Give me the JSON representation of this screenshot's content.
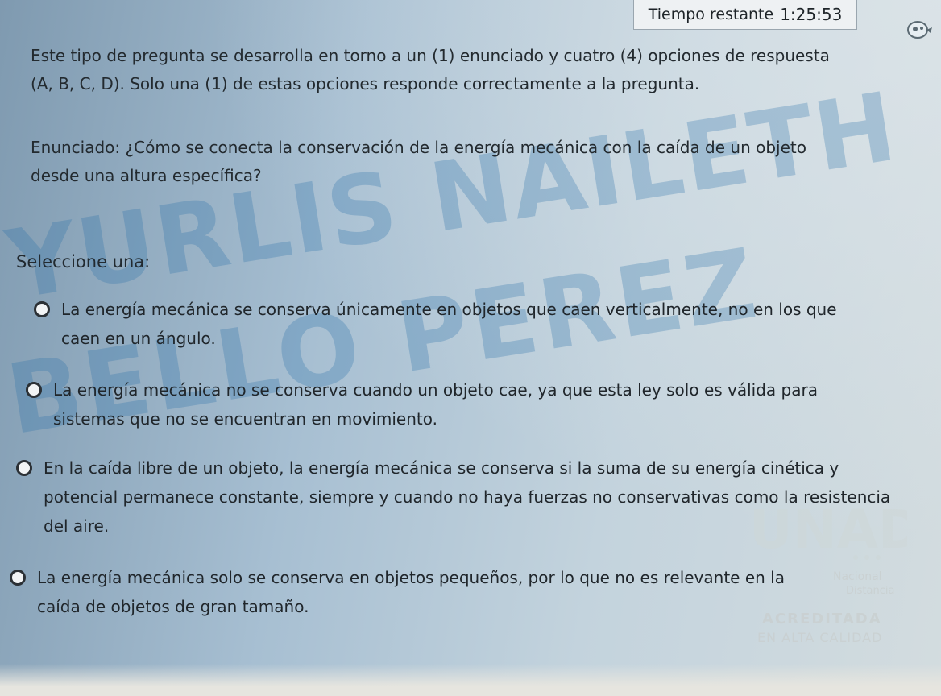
{
  "timer": {
    "label": "Tiempo restante",
    "time": "1:25:53"
  },
  "question": {
    "instructions": "Este tipo de pregunta se desarrolla en torno a un (1) enunciado y cuatro (4) opciones de respuesta (A, B, C, D). Solo una (1) de estas opciones responde correctamente a la pregunta.",
    "stem": "Enunciado: ¿Cómo se conecta la conservación de la energía mecánica con la caída de un objeto desde una altura específica?",
    "select_label": "Seleccione una:"
  },
  "options": [
    {
      "text": "La energía mecánica se conserva únicamente en objetos que caen verticalmente, no en los que caen en un ángulo."
    },
    {
      "text": "La energía mecánica no se conserva cuando un objeto cae, ya que esta ley solo es válida para sistemas que no se encuentran en movimiento."
    },
    {
      "text": "En la caída libre de un objeto, la energía mecánica se conserva si la suma de su energía cinética y potencial permanece constante, siempre y cuando no haya fuerzas no conservativas como la resistencia del aire."
    },
    {
      "text": "La energía mecánica solo se conserva en objetos pequeños, por lo que no es relevante en la caída de objetos de gran tamaño."
    }
  ],
  "watermark": {
    "line1": "YURLIS NAILETH",
    "line2": "BELLO PEREZ"
  },
  "logo": {
    "name": "UNAD",
    "line1": "Nacional",
    "line2": "Distancia",
    "line3": "ACREDITADA",
    "line4": "EN ALTA CALIDAD"
  },
  "colors": {
    "background": "#a7bfd2",
    "watermark": "#286eaa",
    "timer_bg": "#eef1f3"
  }
}
